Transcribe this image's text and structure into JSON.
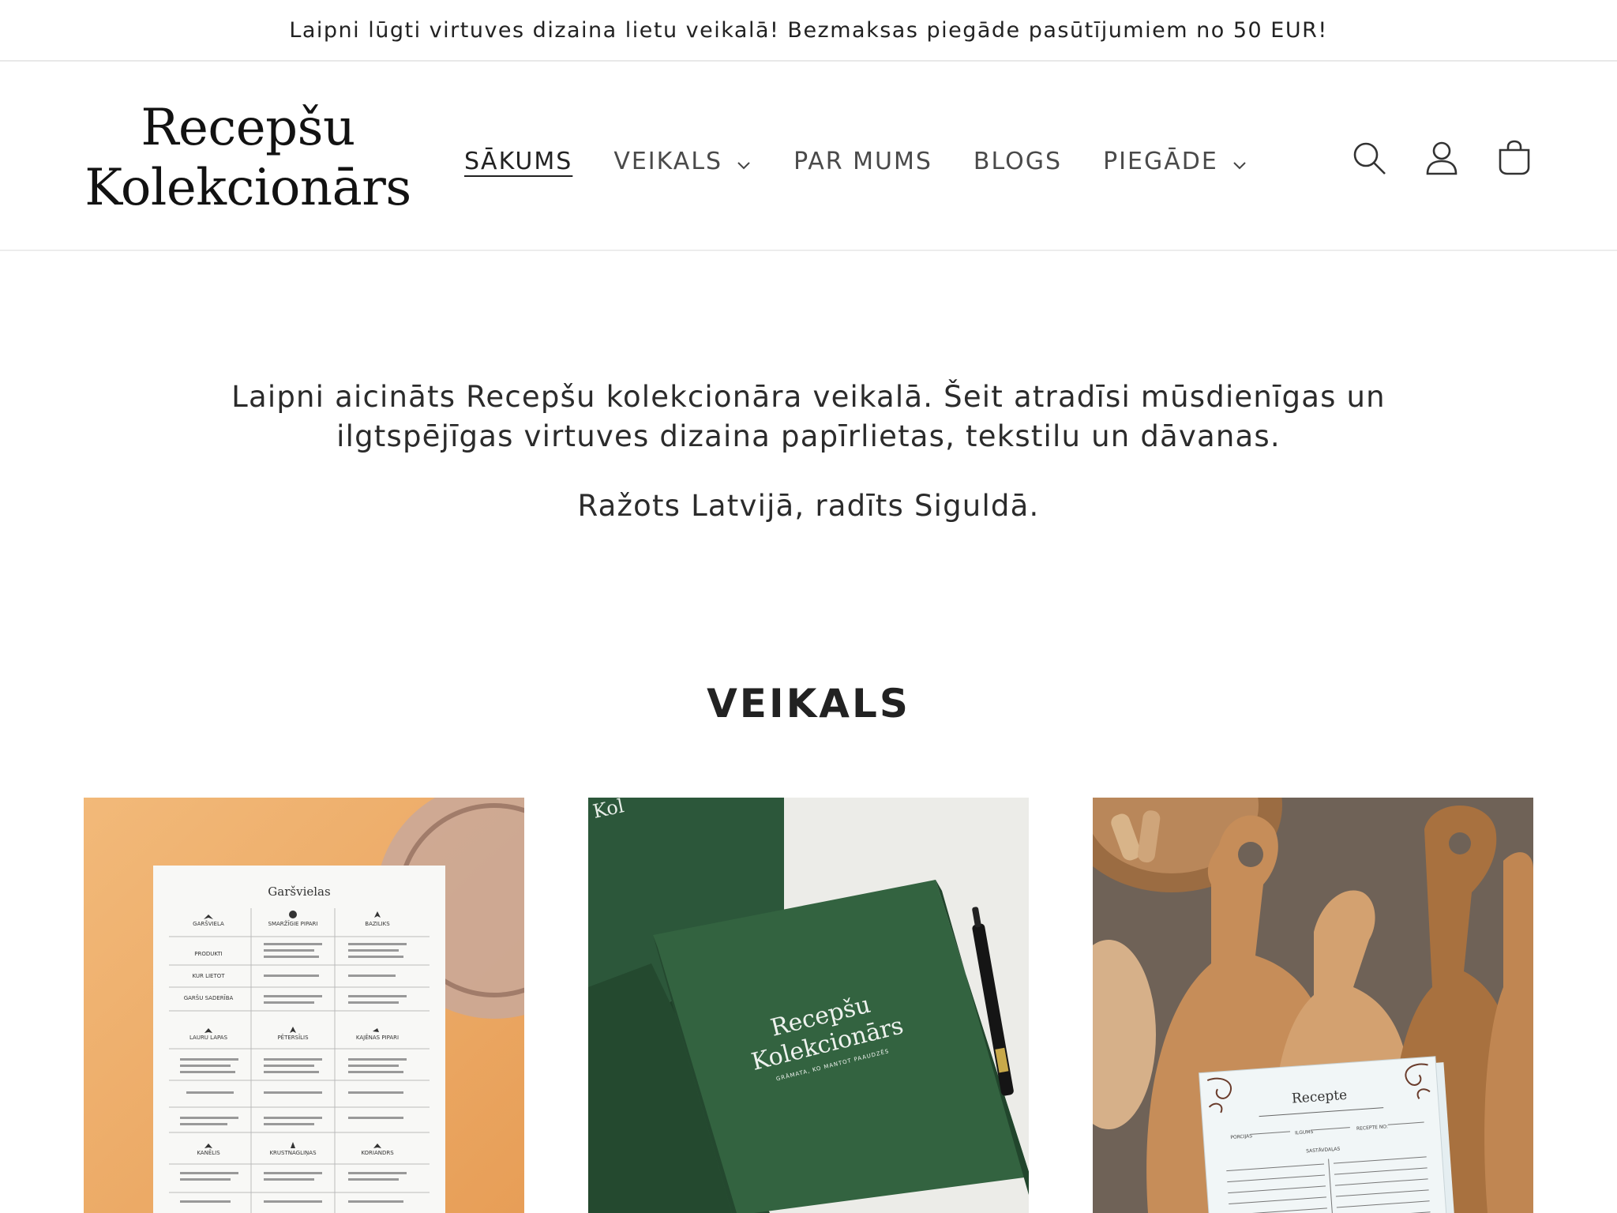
{
  "announcement": "Laipni lūgti virtuves dizaina lietu veikalā! Bezmaksas piegāde pasūtījumiem no 50 EUR!",
  "logo": {
    "line1": "Recepšu",
    "line2": "Kolekcionārs"
  },
  "nav": {
    "items": [
      {
        "label": "SĀKUMS",
        "active": true,
        "dropdown": false
      },
      {
        "label": "VEIKALS",
        "active": false,
        "dropdown": true
      },
      {
        "label": "PAR MUMS",
        "active": false,
        "dropdown": false
      },
      {
        "label": "BLOGS",
        "active": false,
        "dropdown": false
      },
      {
        "label": "PIEGĀDE",
        "active": false,
        "dropdown": true
      }
    ]
  },
  "header_icons": [
    "search-icon",
    "account-icon",
    "cart-icon"
  ],
  "intro": {
    "paragraph1": "Laipni aicināts Recepšu kolekcionāra veikalā. Šeit atradīsi mūsdienīgas un ilgtspējīgas virtuves dizaina papīrlietas, tekstilu un dāvanas.",
    "paragraph2": "Ražots Latvijā, radīts Siguldā."
  },
  "section_title": "VEIKALS",
  "products": [
    {
      "image_text": {
        "title": "Garšvielas",
        "headers": [
          "GARŠVIELA",
          "SMARŽĪGIE PIPARI",
          "BAZILIKS"
        ],
        "rows": [
          "PRODUKTI",
          "KUR LIETOT",
          "GARŠU SADERĪBA"
        ],
        "headers2": [
          "LAURU LAPAS",
          "PĒTERSĪLIS",
          "KAJĒNAS PIPARI"
        ],
        "headers3": [
          "KANĒLIS",
          "KRUSTNAGLIŅAS",
          "KORIANDRS"
        ]
      }
    },
    {
      "image_text": {
        "line1": "Recepšu",
        "line2": "Kolekcionārs",
        "subtitle": "GRĀMATA, KO MANTOT PAAUDZĒS",
        "spine": "Kol"
      }
    },
    {
      "image_text": {
        "title": "Recepte",
        "fields": [
          "PORCIJAS",
          "ILGUMS",
          "RECEPTE NO:"
        ],
        "section": "SASTĀVDAĻAS"
      }
    }
  ],
  "colors": {
    "text": "#222222",
    "border": "#e8e8e8",
    "book_green": "#2f5b3c",
    "peach": "#eeaa66",
    "wood": "#b07a4c"
  }
}
